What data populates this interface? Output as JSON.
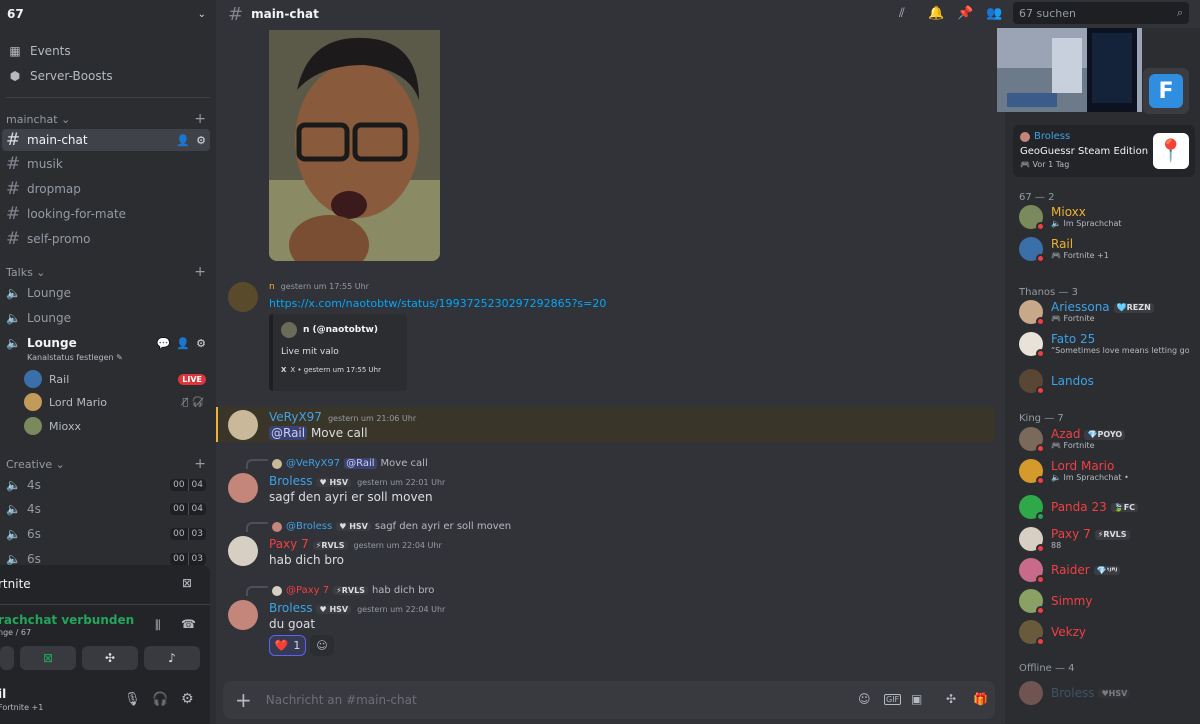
{
  "server": {
    "name": "67"
  },
  "top_items": [
    {
      "label": "Events",
      "icon": "calendar-icon"
    },
    {
      "label": "Server-Boosts",
      "icon": "boost-icon"
    }
  ],
  "categories": {
    "mainchat": "mainchat",
    "talks": "Talks",
    "creative": "Creative"
  },
  "text_channels": [
    "main-chat",
    "musik",
    "dropmap",
    "looking-for-mate",
    "self-promo"
  ],
  "voice_channels": {
    "lounge1": "Lounge",
    "lounge2": "Lounge",
    "lounge3": "Lounge",
    "lounge3_status": "Kanalstatus festlegen",
    "users": [
      {
        "name": "Rail",
        "badge": "LIVE"
      },
      {
        "name": "Lord Mario"
      },
      {
        "name": "Mioxx"
      }
    ],
    "creative": [
      {
        "name": "4s",
        "a": "00",
        "b": "04"
      },
      {
        "name": "4s",
        "a": "00",
        "b": "04"
      },
      {
        "name": "6s",
        "a": "00",
        "b": "03"
      },
      {
        "name": "6s",
        "a": "00",
        "b": "03"
      }
    ]
  },
  "stream_panel": {
    "game": "rtnite",
    "status": "rachchat verbunden",
    "location": "nge / 67",
    "user": "il",
    "user_status": "Fortnite +1"
  },
  "header": {
    "channel": "main-chat",
    "search_placeholder": "67 suchen"
  },
  "messages": {
    "m1": {
      "author": "n",
      "time": "gestern um 17:55 Uhr",
      "link": "https://x.com/naotobtw/status/1993725230297292865?s=20",
      "embed_author": "n (@naotobtw)",
      "embed_text": "Live mit valo",
      "embed_footer_icon": "X",
      "embed_footer": "X • gestern um 17:55 Uhr"
    },
    "m2": {
      "author": "VeRyX97",
      "time": "gestern um 21:06 Uhr",
      "mention": "@Rail",
      "text": "Move call"
    },
    "m3": {
      "reply_author": "@VeRyX97",
      "reply_mention": "@Rail",
      "reply_text": "Move call",
      "author": "Broless",
      "tag": "HSV",
      "time": "gestern um 22:01 Uhr",
      "text": "sagf den ayri er soll moven"
    },
    "m4": {
      "reply_author": "@Broless",
      "reply_tag": "HSV",
      "reply_text": "sagf den ayri er soll moven",
      "author": "Paxy 7",
      "tag": "RVLS",
      "time": "gestern um 22:04 Uhr",
      "text": "hab dich bro"
    },
    "m5": {
      "reply_author": "@Paxy 7",
      "reply_tag": "RVLS",
      "reply_text": "hab dich bro",
      "author": "Broless",
      "tag": "HSV",
      "time": "gestern um 22:04 Uhr",
      "text": "du goat",
      "reaction_emoji": "❤️",
      "reaction_count": "1"
    }
  },
  "composer": {
    "placeholder": "Nachricht an #main-chat"
  },
  "activity": {
    "user": "Broless",
    "game": "GeoGuessr Steam Edition",
    "time": "Vor 1 Tag"
  },
  "member_groups": {
    "g1": "67 — 2",
    "g2": "Thanos — 3",
    "g3": "King — 7",
    "g4": "Offline — 4"
  },
  "members": [
    {
      "name": "Mioxx",
      "status": "Im Sprachchat",
      "color": "#f0b232"
    },
    {
      "name": "Rail",
      "status": "Fortnite +1",
      "color": "#f0b232"
    },
    {
      "name": "Ariessona",
      "tag": "REZN",
      "status": "Fortnite",
      "color": "#3ea2e8"
    },
    {
      "name": "Fato 25",
      "status": "“Sometimes love means letting go,...",
      "color": "#3ea2e8"
    },
    {
      "name": "Landos",
      "status": "",
      "color": "#3ea2e8"
    },
    {
      "name": "Azad",
      "tag": "POYO",
      "status": "Fortnite",
      "color": "#f23f43"
    },
    {
      "name": "Lord Mario",
      "status": "Im Sprachchat •",
      "color": "#f23f43"
    },
    {
      "name": "Panda 23",
      "tag": "FC",
      "status": "",
      "color": "#f23f43"
    },
    {
      "name": "Paxy 7",
      "tag": "RVLS",
      "status": "88",
      "color": "#f23f43"
    },
    {
      "name": "Raider",
      "tag": "ᵗᴶᴿᴶ",
      "status": "",
      "color": "#f23f43"
    },
    {
      "name": "Simmy",
      "status": "",
      "color": "#f23f43"
    },
    {
      "name": "Vekzy",
      "status": "",
      "color": "#f23f43"
    },
    {
      "name": "Broless",
      "tag": "HSV",
      "status": "",
      "color": "#5b7fa6"
    }
  ],
  "colors": {
    "accent": "#5865f2",
    "link": "#00a8fc",
    "online": "#23a55a",
    "dnd": "#f23f43",
    "voice_connected": "#23a55a"
  }
}
